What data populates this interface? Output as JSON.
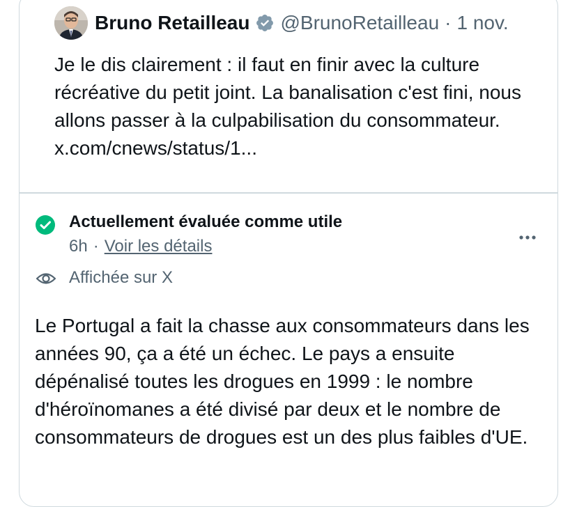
{
  "tweet": {
    "author_name": "Bruno Retailleau",
    "verified_icon": "verified-badge-icon",
    "handle": "@BrunoRetailleau",
    "separator": "·",
    "date": "1 nov.",
    "text": "Je le dis clairement : il faut en finir avec la culture récréative du petit joint. La banalisation c'est fini, nous allons passer à la culpabilisation du consommateur. x.com/cnews/status/1..."
  },
  "community_note": {
    "status_icon": "check-circle-icon",
    "status": "Actuellement évaluée comme utile",
    "age": "6h",
    "separator": "·",
    "details_link": "Voir les détails",
    "more_icon": "more-horizontal-icon",
    "shown_icon": "eye-icon",
    "shown_on": "Affichée sur X",
    "text": "Le Portugal a fait la chasse aux consommateurs dans les années 90, ça a été un échec. Le pays a ensuite dépénalisé toutes les drogues en 1999 : le nombre d'héroïnomanes a été divisé par deux et le nombre de consommateurs de drogues est un des plus faibles d'UE."
  },
  "colors": {
    "text_primary": "#0f1419",
    "text_secondary": "#536471",
    "border": "#cfd9de",
    "verified_badge": "#829aab",
    "helpful_green": "#00ba7c"
  }
}
